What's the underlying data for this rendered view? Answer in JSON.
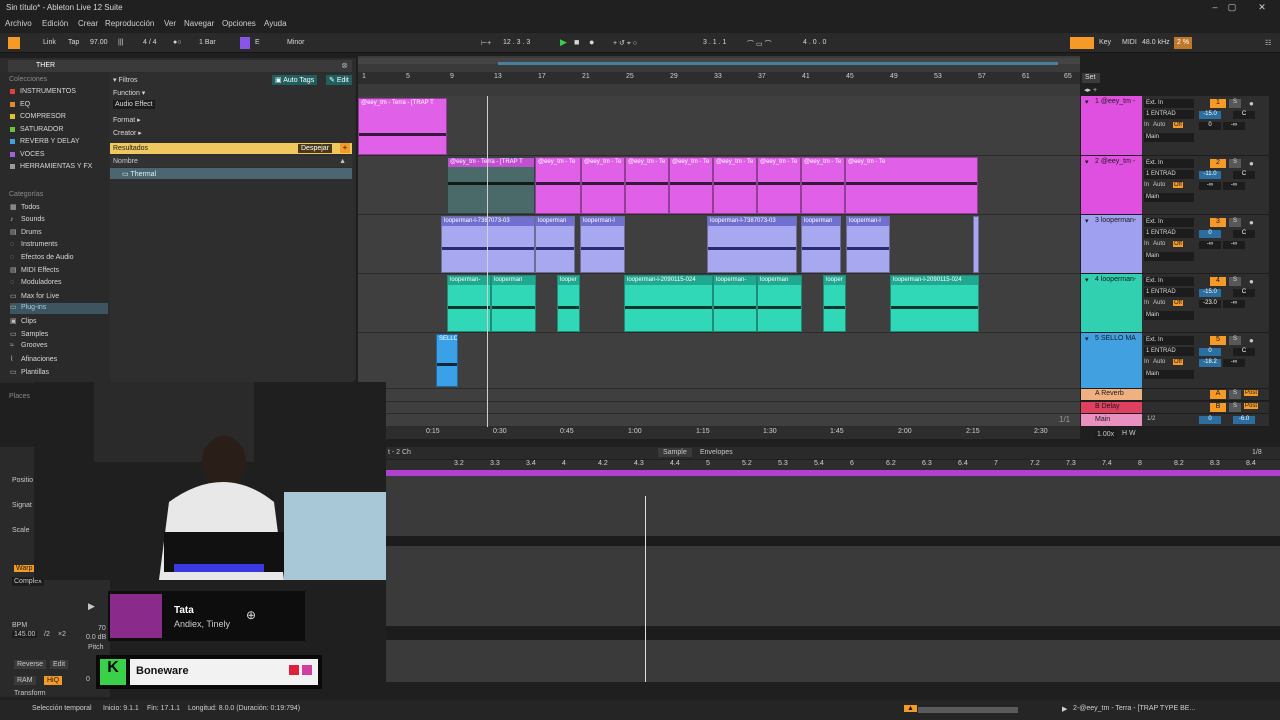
{
  "window": {
    "title": "Sin título* - Ableton Live 12 Suite"
  },
  "menu": [
    "Archivo",
    "Edición",
    "Crear",
    "Reproducción",
    "Ver",
    "Navegar",
    "Opciones",
    "Ayuda"
  ],
  "transport": {
    "link": "Link",
    "tap": "Tap",
    "tempo": "97.00",
    "signature": "4 / 4",
    "quantize": "1 Bar",
    "key": "E",
    "scale": "Minor",
    "position": "12 .   3 .   3",
    "loop_start": "3 .   1 .   1",
    "loop_length": "4 .   0 .   0",
    "key_label": "Key",
    "midi_label": "MIDI",
    "sample_rate": "48.0 kHz",
    "cpu": "2 %"
  },
  "browser": {
    "search": "THER",
    "collections_header": "Colecciones",
    "collections": [
      {
        "label": "INSTRUMENTOS",
        "color": "#e04040"
      },
      {
        "label": "EQ",
        "color": "#e08a2a"
      },
      {
        "label": "COMPRESOR",
        "color": "#e0c030"
      },
      {
        "label": "SATURADOR",
        "color": "#70c040"
      },
      {
        "label": "REVERB Y DELAY",
        "color": "#40a0e0"
      },
      {
        "label": "VOCES",
        "color": "#a060e0"
      },
      {
        "label": "HERRAMIENTAS Y FX",
        "color": "#9a9a9a"
      }
    ],
    "categories_header": "Categorías",
    "categories": [
      "Todos",
      "Sounds",
      "Drums",
      "Instruments",
      "Efectos de Audio",
      "MIDI Effects",
      "Moduladores",
      "Max for Live",
      "Plug-ins",
      "Clips",
      "Samples",
      "Grooves",
      "Afinaciones",
      "Plantillas"
    ],
    "places_header": "Places",
    "filters_label": "Filtros",
    "auto_tags": "Auto Tags",
    "edit": "Edit",
    "function_label": "Function",
    "function_value": "Audio Effect",
    "format_label": "Format",
    "creator_label": "Creator",
    "results_label": "Resultados",
    "clear_label": "Despejar",
    "name_col": "Nombre",
    "result_item": "Thermal"
  },
  "ruler": {
    "bars": [
      "1",
      "5",
      "9",
      "13",
      "17",
      "21",
      "25",
      "29",
      "33",
      "37",
      "41",
      "45",
      "49",
      "53",
      "57",
      "61",
      "65"
    ],
    "set": "Set"
  },
  "timeline": [
    "0:15",
    "0:30",
    "0:45",
    "1:00",
    "1:15",
    "1:30",
    "1:45",
    "2:00",
    "2:15",
    "2:30"
  ],
  "tracks": [
    {
      "name": "1 @eey_tm -",
      "color": "#e050e0",
      "num": "1",
      "input": "Ext. In",
      "channel": "1 ENTRAD",
      "vol": "-15.0",
      "pan": "C",
      "send": "0",
      "send2": "-∞",
      "out": "Main"
    },
    {
      "name": "2 @eey_tm -",
      "color": "#e050e0",
      "num": "2",
      "input": "Ext. In",
      "channel": "1 ENTRAD",
      "vol": "-11.0",
      "pan": "C",
      "send": "-∞",
      "send2": "-∞",
      "out": "Main"
    },
    {
      "name": "3 looperman-",
      "color": "#a0a0f0",
      "num": "3",
      "input": "Ext. In",
      "channel": "1 ENTRAD",
      "vol": "0",
      "pan": "C",
      "send": "-∞",
      "send2": "-∞",
      "out": "Main"
    },
    {
      "name": "4 looperman-",
      "color": "#30d0b0",
      "num": "4",
      "input": "Ext. In",
      "channel": "1 ENTRAD",
      "vol": "-15.0",
      "pan": "C",
      "send": "-23.0",
      "send2": "-∞",
      "out": "Main"
    },
    {
      "name": "5 SELLO MA",
      "color": "#40a0e0",
      "num": "5",
      "input": "Ext. In",
      "channel": "1 ENTRAD",
      "vol": "0",
      "pan": "C",
      "send": "-18.2",
      "send2": "-∞",
      "out": "Main"
    }
  ],
  "io_labels": {
    "in": "In",
    "auto": "Auto",
    "off": "Off"
  },
  "returns": [
    {
      "name": "A Reverb",
      "letter": "A",
      "color": "#f0b080"
    },
    {
      "name": "B Delay",
      "letter": "B",
      "color": "#e04060"
    },
    {
      "name": "Main",
      "letter": "",
      "color": "#e890c0"
    }
  ],
  "main_out": {
    "ratio": "1/2",
    "vol": "0",
    "peak": "-6.0",
    "zoom": "1.00x"
  },
  "clips": {
    "t1": [
      "@eey_tm - Terra - [TRAP T"
    ],
    "t2": [
      "@eey_tm - Terra - [TRAP T",
      "@eey_tm - Te",
      "@eey_tm - Te",
      "@eey_tm - Te",
      "@eey_tm - Te",
      "@eey_tm - Te",
      "@eey_tm - Te",
      "@eey_tm - Te",
      "@eey_tm - Te"
    ],
    "t3": [
      "looperman-l-7387073-03",
      "looperman",
      "looperman-l",
      "looperman-l-7387073-03",
      "looperman",
      "looperman-l"
    ],
    "t4": [
      "looperman-",
      "looperman",
      "looper",
      "looperman-l-2090115-024",
      "looperman-",
      "looperman",
      "looper",
      "looperman-l-2090115-024"
    ],
    "t5": [
      "SELLO"
    ]
  },
  "page_count": "1/1",
  "detail": {
    "title": "t - 2 Ch",
    "tabs": [
      "Sample",
      "Envelopes"
    ],
    "page": "1/8",
    "ruler": [
      "3.2",
      "3.3",
      "3.4",
      "4",
      "4.2",
      "4.3",
      "4.4",
      "5",
      "5.2",
      "5.3",
      "5.4",
      "6",
      "6.2",
      "6.3",
      "6.4",
      "7",
      "7.2",
      "7.3",
      "7.4",
      "8",
      "8.2",
      "8.3",
      "8.4"
    ]
  },
  "clipview": {
    "labels": [
      "Positio",
      "Signat",
      "Scale",
      "Warp",
      "BPM",
      "Pitch"
    ],
    "bpm": "145.00",
    "half": "/2",
    "double": "×2",
    "reverse": "Reverse",
    "edit": "Edit",
    "ram": "RAM",
    "hiq": "HiQ",
    "complex": "Complex",
    "transform": "Transform",
    "gain": "0.0 dB",
    "seventy": "70",
    "zero": "0"
  },
  "now_playing": {
    "title": "Tata",
    "artist": "Andiex, Tinely"
  },
  "brand": {
    "name": "Boneware",
    "logo": "K"
  },
  "status": {
    "sel": "Selección temporal",
    "start": "Inicio: 9.1.1",
    "end": "Fin: 17.1.1",
    "length": "Longitud: 8.0.0 (Duración: 0:19:794)",
    "right": "2-@eey_tm - Terra - [TRAP TYPE BE..."
  }
}
